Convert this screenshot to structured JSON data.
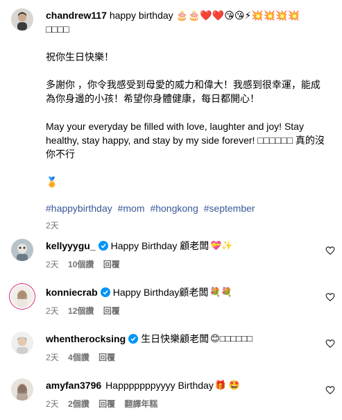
{
  "post": {
    "username": "chandrew117",
    "caption_intro": "happy birthday",
    "caption_emojis": "🎂🎂❤️❤️😘😘⚡💥💥💥💥",
    "caption_boxes": "□□□□",
    "line_chinese1": "祝你生日快樂！",
    "line_chinese2a": "多謝你 ，你令我感受到母愛的威力和偉大！我感到很幸運，能成",
    "line_chinese2b": "為你身邊的小孩！希望你身體健康，每日都開心！",
    "line_en1": "May your everyday be filled with love, laughter and joy! Stay",
    "line_en2": "healthy, stay happy, and stay by my side forever! □□□□□□ 真的沒",
    "line_en3": "你不行",
    "medal": "🏅",
    "hashtags": [
      "#happybirthday",
      "#mom",
      "#hongkong",
      "#september"
    ],
    "time": "2天"
  },
  "comments": [
    {
      "username": "kellyyygu_",
      "verified": true,
      "text": "Happy Birthday 顧老闆",
      "emoji": "💝✨",
      "time": "2天",
      "likes": "10個讚",
      "reply": "回覆",
      "translate": ""
    },
    {
      "username": "konniecrab",
      "verified": true,
      "text": "Happy Birthday顧老闆",
      "emoji": "💐💐",
      "time": "2天",
      "likes": "12個讚",
      "reply": "回覆",
      "translate": ""
    },
    {
      "username": "whentherocksing",
      "verified": true,
      "text": "生日快樂顧老闆",
      "emoji": "😊□□□□□□",
      "time": "2天",
      "likes": "4個讚",
      "reply": "回覆",
      "translate": ""
    },
    {
      "username": "amyfan3796",
      "verified": false,
      "text": "Happpppppyyyy Birthday",
      "emoji": "🎁 🤩",
      "time": "2天",
      "likes": "2個讚",
      "reply": "回覆",
      "translate": "翻譯年糕"
    }
  ],
  "colors": {
    "hashtag": "#385898",
    "meta": "#737373",
    "verified": "#0095f6"
  }
}
